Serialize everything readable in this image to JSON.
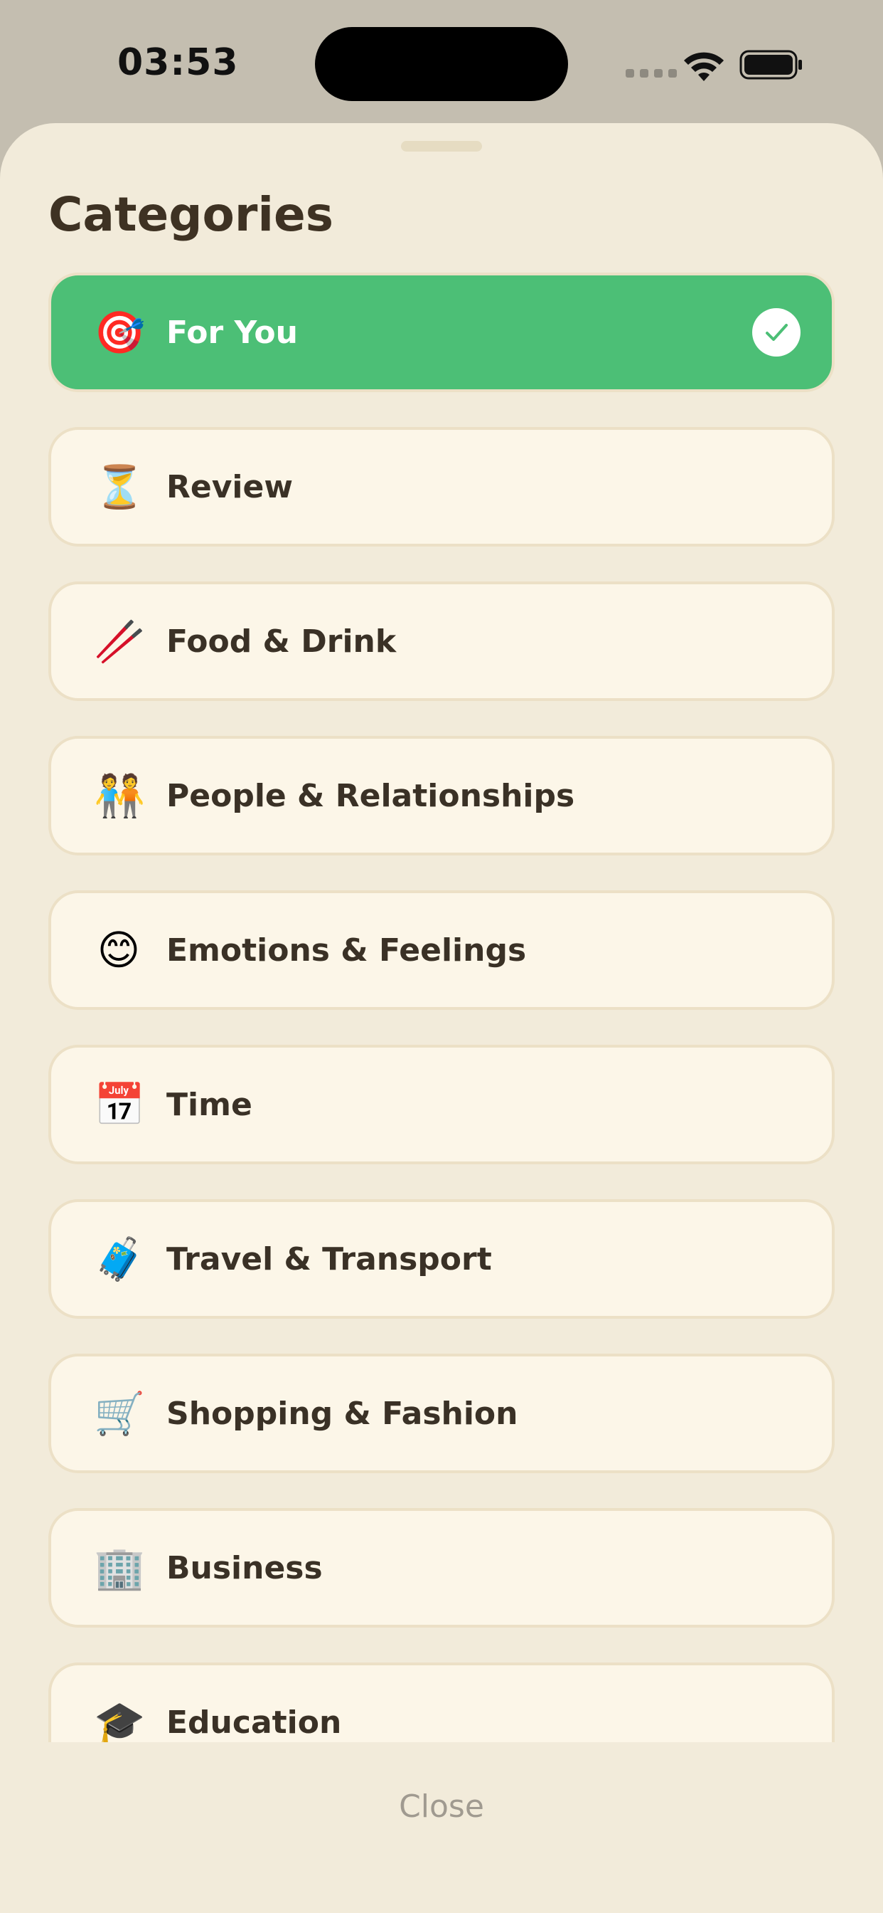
{
  "status_bar": {
    "time": "03:53"
  },
  "sheet": {
    "title": "Categories",
    "close_label": "Close"
  },
  "categories": [
    {
      "label": "For You",
      "icon": "🎯",
      "icon_name": "target-icon",
      "selected": true
    },
    {
      "label": "Review",
      "icon": "⏳",
      "icon_name": "hourglass-icon",
      "selected": false
    },
    {
      "label": "Food & Drink",
      "icon": "🥢",
      "icon_name": "chopsticks-icon",
      "selected": false
    },
    {
      "label": "People & Relationships",
      "icon": "🧑‍🤝‍🧑",
      "icon_name": "people-holding-hands-icon",
      "selected": false
    },
    {
      "label": "Emotions & Feelings",
      "icon": "😊",
      "icon_name": "smiling-face-icon",
      "selected": false
    },
    {
      "label": "Time",
      "icon": "📅",
      "icon_name": "calendar-icon",
      "selected": false
    },
    {
      "label": "Travel & Transport",
      "icon": "🧳",
      "icon_name": "luggage-icon",
      "selected": false
    },
    {
      "label": "Shopping & Fashion",
      "icon": "🛒",
      "icon_name": "shopping-cart-icon",
      "selected": false
    },
    {
      "label": "Business",
      "icon": "🏢",
      "icon_name": "office-building-icon",
      "selected": false
    },
    {
      "label": "Education",
      "icon": "🎓",
      "icon_name": "graduation-cap-icon",
      "selected": false
    }
  ],
  "colors": {
    "selected_background": "#4cbf76",
    "item_background": "#fcf6e8",
    "sheet_background": "#f2ebda",
    "text": "#3a3126"
  }
}
